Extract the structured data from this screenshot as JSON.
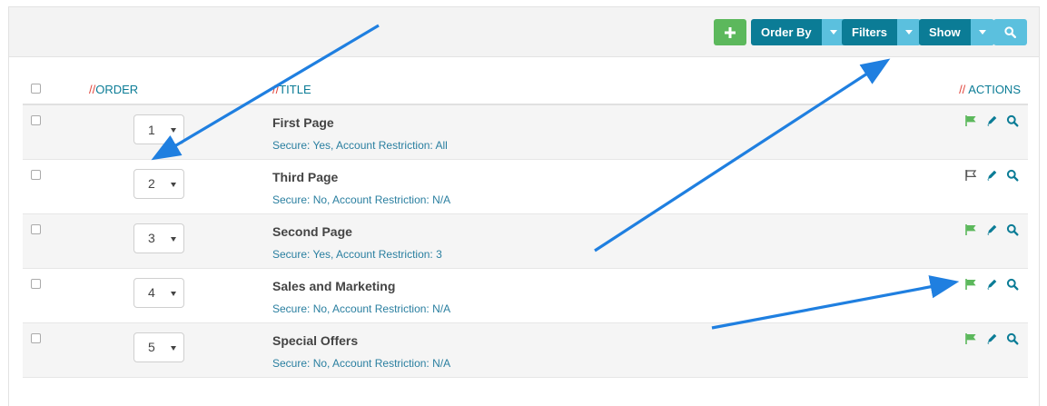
{
  "toolbar": {
    "add_icon": "plus-icon",
    "order_by_label": "Order By",
    "filters_label": "Filters",
    "show_label": "Show",
    "search_icon": "search-icon",
    "colors": {
      "add": "#5cb85c",
      "primary": "#0b7c96",
      "caret": "#5bc0de"
    }
  },
  "table": {
    "header": {
      "order_prefix": "//",
      "order_label": "ORDER",
      "title_prefix": "//",
      "title_label": "TITLE",
      "actions_prefix": "//",
      "actions_label": "ACTIONS"
    },
    "rows": [
      {
        "order": "1",
        "title": "First Page",
        "subtitle": "Secure: Yes, Account Restriction: All",
        "flag": "published"
      },
      {
        "order": "2",
        "title": "Third Page",
        "subtitle": "Secure: No, Account Restriction: N/A",
        "flag": "unpublished"
      },
      {
        "order": "3",
        "title": "Second Page",
        "subtitle": "Secure: Yes, Account Restriction: 3",
        "flag": "published"
      },
      {
        "order": "4",
        "title": "Sales and Marketing",
        "subtitle": "Secure: No, Account Restriction: N/A",
        "flag": "published"
      },
      {
        "order": "5",
        "title": "Special Offers",
        "subtitle": "Secure: No, Account Restriction: N/A",
        "flag": "published"
      }
    ]
  },
  "annotation_color": "#1f7fe0"
}
